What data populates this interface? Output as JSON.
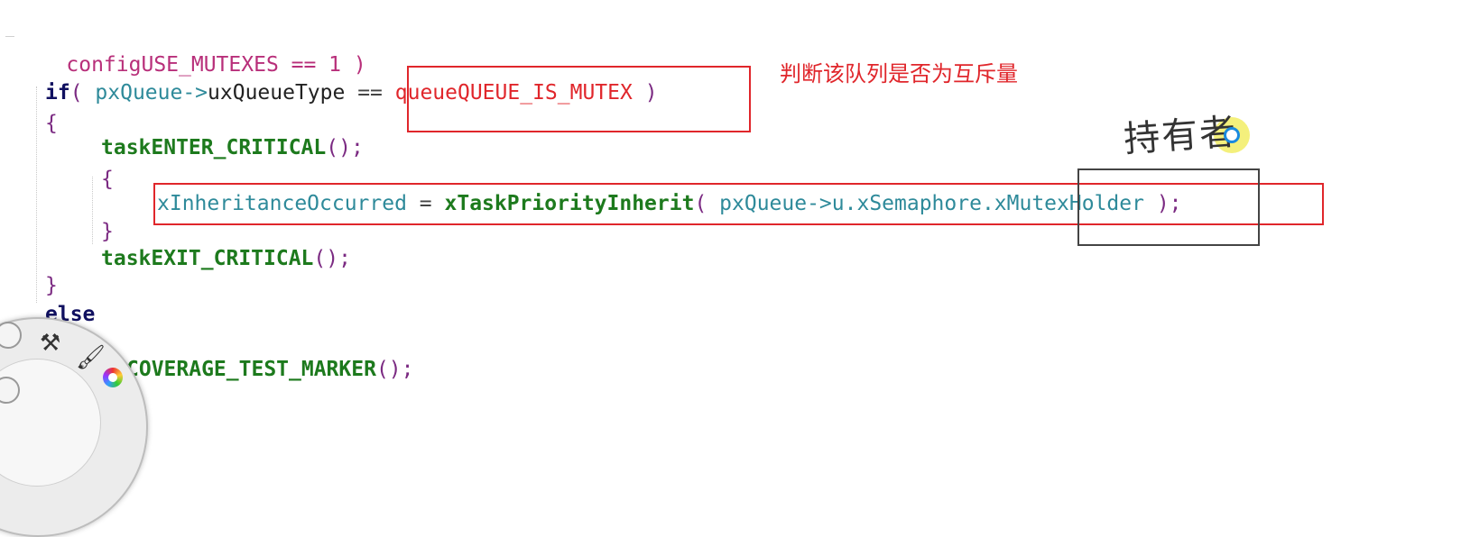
{
  "code": {
    "line1": {
      "text": "configUSE_MUTEXES == 1 )"
    },
    "line2": {
      "kw": "if",
      "open": "( ",
      "var": "pxQueue->",
      "plain": "uxQueueType ",
      "op": "== ",
      "mac": "queueQUEUE_IS_MUTEX",
      "close": " )"
    },
    "line3": {
      "text": "{"
    },
    "line4": {
      "fn": "taskENTER_CRITICAL",
      "punct": "();"
    },
    "line5": {
      "text": "{"
    },
    "line6": {
      "var1": "xInheritanceOccurred",
      "op": " = ",
      "fn": "xTaskPriorityInherit",
      "open": "( ",
      "var2": "pxQueue->u.xSemaphore.",
      "var3": "xMutexHolder",
      "close": " );"
    },
    "line7": {
      "text": "}"
    },
    "line8": {
      "fn": "taskEXIT_CRITICAL",
      "punct": "();"
    },
    "line9": {
      "text": "}"
    },
    "line10": {
      "kw": "else"
    },
    "line11": {
      "fn": "COVERAGE_TEST_MARKER",
      "punct": "();"
    }
  },
  "annotations": {
    "note_mutex": "判断该队列是否为互斥量",
    "handwritten_holder": "持有者"
  },
  "colors": {
    "annotation_red": "#e0262b",
    "keyword": "#101060",
    "function": "#1d7a1d",
    "macro": "#b82f7a",
    "identifier": "#2e8a9a"
  },
  "tool_wheel": {
    "icons": [
      "tools-icon",
      "brush-icon",
      "color-picker-icon",
      "settings-icon"
    ]
  }
}
